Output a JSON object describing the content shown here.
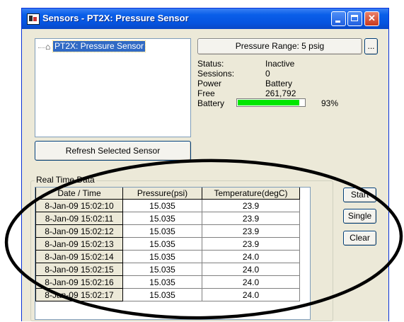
{
  "window": {
    "title": "Sensors - PT2X: Pressure Sensor"
  },
  "tree": {
    "selected_item": "PT2X: Pressure Sensor"
  },
  "buttons": {
    "refresh": "Refresh Selected Sensor",
    "range": "Pressure Range: 5 psig",
    "more": "...",
    "start": "Start",
    "single": "Single",
    "clear": "Clear"
  },
  "info": {
    "status_label": "Status:",
    "status_value": "Inactive",
    "sessions_label": "Sessions:",
    "sessions_value": "0",
    "power_label": "Power",
    "power_value": "Battery",
    "free_label": "Free",
    "free_value": "261,792",
    "battery_label": "Battery",
    "battery_percent_text": "93%",
    "battery_level": 0.93,
    "battery_color": "#00e600"
  },
  "realtime": {
    "group_label": "Real Time Data",
    "columns": [
      "Date / Time",
      "Pressure(psi)",
      "Temperature(degC)"
    ],
    "rows": [
      [
        "8-Jan-09 15:02:10",
        "15.035",
        "23.9"
      ],
      [
        "8-Jan-09 15:02:11",
        "15.035",
        "23.9"
      ],
      [
        "8-Jan-09 15:02:12",
        "15.035",
        "23.9"
      ],
      [
        "8-Jan-09 15:02:13",
        "15.035",
        "23.9"
      ],
      [
        "8-Jan-09 15:02:14",
        "15.035",
        "24.0"
      ],
      [
        "8-Jan-09 15:02:15",
        "15.035",
        "24.0"
      ],
      [
        "8-Jan-09 15:02:16",
        "15.035",
        "24.0"
      ],
      [
        "8-Jan-09 15:02:17",
        "15.035",
        "24.0"
      ]
    ]
  },
  "icons": {
    "app": "sensor-app-icon",
    "tree_item": "sensor-node-icon",
    "minimize": "minimize-icon",
    "maximize": "maximize-icon",
    "close": "close-icon"
  }
}
